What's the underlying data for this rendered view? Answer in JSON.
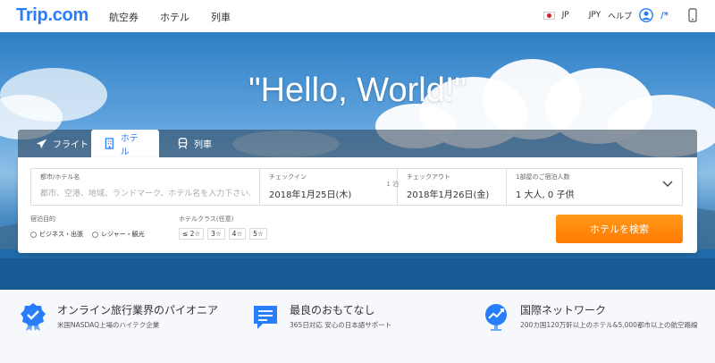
{
  "header": {
    "logo": "Trip.com",
    "nav": [
      "航空券",
      "ホテル",
      "列車"
    ],
    "lang": "JP",
    "currency": "JPY",
    "help": "ヘルプ",
    "user_short": "/*"
  },
  "hero": {
    "title": "\"Hello, World!\""
  },
  "tabs": [
    {
      "label": "フライト",
      "icon": "airplane-icon"
    },
    {
      "label": "ホテル",
      "icon": "hotel-icon"
    },
    {
      "label": "列車",
      "icon": "train-icon"
    }
  ],
  "active_tab": "ホテル",
  "form": {
    "destination_label": "都市/ホテル名",
    "destination_placeholder": "都市、空港、地域、ランドマーク、ホテル名を入力下さい。",
    "checkin_label": "チェックイン",
    "checkin_value": "2018年1月25日(木)",
    "nights": "1 泊",
    "checkout_label": "チェックアウト",
    "checkout_value": "2018年1月26日(金)",
    "guests_label": "1部屋のご宿泊人数",
    "guests_value": "1 大人, 0 子供",
    "purpose_label": "宿泊目的",
    "purpose_options": [
      "ビジネス・出張",
      "レジャー・観光"
    ],
    "class_label": "ホテルクラス(任意)",
    "class_options": [
      "≤ 2☆",
      "3☆",
      "4☆",
      "5☆"
    ],
    "search_button": "ホテルを検索"
  },
  "features": [
    {
      "title": "オンライン旅行業界のパイオニア",
      "desc": "米国NASDAQ上場のハイテク企業",
      "icon": "badge-check-icon"
    },
    {
      "title": "最良のおもてなし",
      "desc": "365日対応 安心の日本語サポート",
      "icon": "chat-icon"
    },
    {
      "title": "国際ネットワーク",
      "desc": "200カ国120万軒以上のホテル&5,000都市以上の航空路線",
      "icon": "globe-chart-icon"
    }
  ],
  "colors": {
    "brand": "#287dfa",
    "accent": "#ff8a00"
  }
}
